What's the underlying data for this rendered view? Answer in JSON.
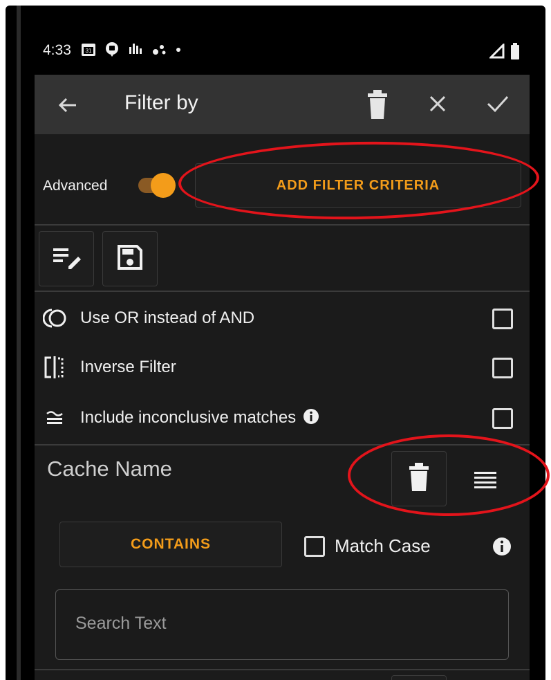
{
  "status_bar": {
    "time": "4:33",
    "icons": [
      "calendar-icon",
      "notification-icon",
      "signal-bars-icon",
      "nfc-icon",
      "dot-icon"
    ],
    "right_icons": [
      "cell-signal-icon",
      "battery-icon"
    ]
  },
  "app_bar": {
    "title": "Filter by",
    "icons": [
      "back-arrow-icon",
      "trash-icon",
      "close-icon",
      "check-icon"
    ]
  },
  "advanced": {
    "label": "Advanced",
    "toggle_on": true,
    "add_button_label": "ADD FILTER CRITERIA"
  },
  "tools": [
    "edit-list-icon",
    "save-icon"
  ],
  "options": [
    {
      "label": "Use OR instead of AND",
      "icon": "or-logic-icon",
      "checked": false
    },
    {
      "label": "Inverse Filter",
      "icon": "inverse-filter-icon",
      "checked": false
    },
    {
      "label": "Include inconclusive matches",
      "icon": "approx-equal-icon",
      "checked": false,
      "has_info": true
    }
  ],
  "cache_name": {
    "title": "Cache Name",
    "operator_label": "CONTAINS",
    "match_case_label": "Match Case",
    "match_case_checked": false,
    "search_placeholder": "Search Text"
  },
  "colors": {
    "accent": "#f39c1a",
    "background": "#1b1b1b",
    "app_bar": "#333333",
    "annotation": "#e3141b"
  }
}
